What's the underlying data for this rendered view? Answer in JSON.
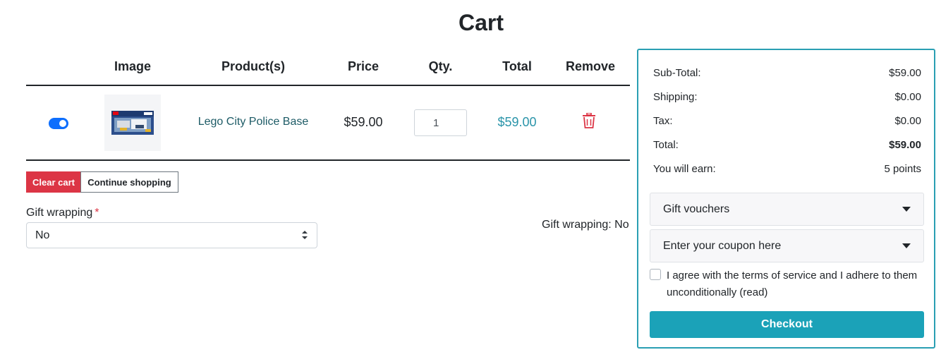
{
  "page": {
    "title": "Cart"
  },
  "table": {
    "headers": [
      "Image",
      "Product(s)",
      "Price",
      "Qty.",
      "Total",
      "Remove"
    ],
    "rows": [
      {
        "product_name": "Lego City Police Base",
        "price": "$59.00",
        "qty": "1",
        "total": "$59.00",
        "image_icon": "lego-box-image",
        "remove_icon": "trash-icon",
        "selected": true
      }
    ]
  },
  "actions": {
    "clear_cart": "Clear cart",
    "continue_shopping": "Continue shopping"
  },
  "gift_wrapping": {
    "label": "Gift wrapping",
    "required_mark": "*",
    "selected": "No",
    "summary": "Gift wrapping: No"
  },
  "summary": {
    "lines": [
      {
        "label": "Sub-Total:",
        "value": "$59.00"
      },
      {
        "label": "Shipping:",
        "value": "$0.00"
      },
      {
        "label": "Tax:",
        "value": "$0.00"
      },
      {
        "label": "Total:",
        "value": "$59.00"
      },
      {
        "label": "You will earn:",
        "value": "5 points"
      }
    ],
    "gift_vouchers": "Gift vouchers",
    "coupon": "Enter your coupon here",
    "terms": "I agree with the terms of service and I adhere to them unconditionally (read)",
    "checkout": "Checkout"
  },
  "colors": {
    "accent": "#1ba2b8",
    "danger": "#dc3545",
    "toggle": "#0d6efd",
    "link": "#1d5b66",
    "total": "#2a94a9"
  }
}
